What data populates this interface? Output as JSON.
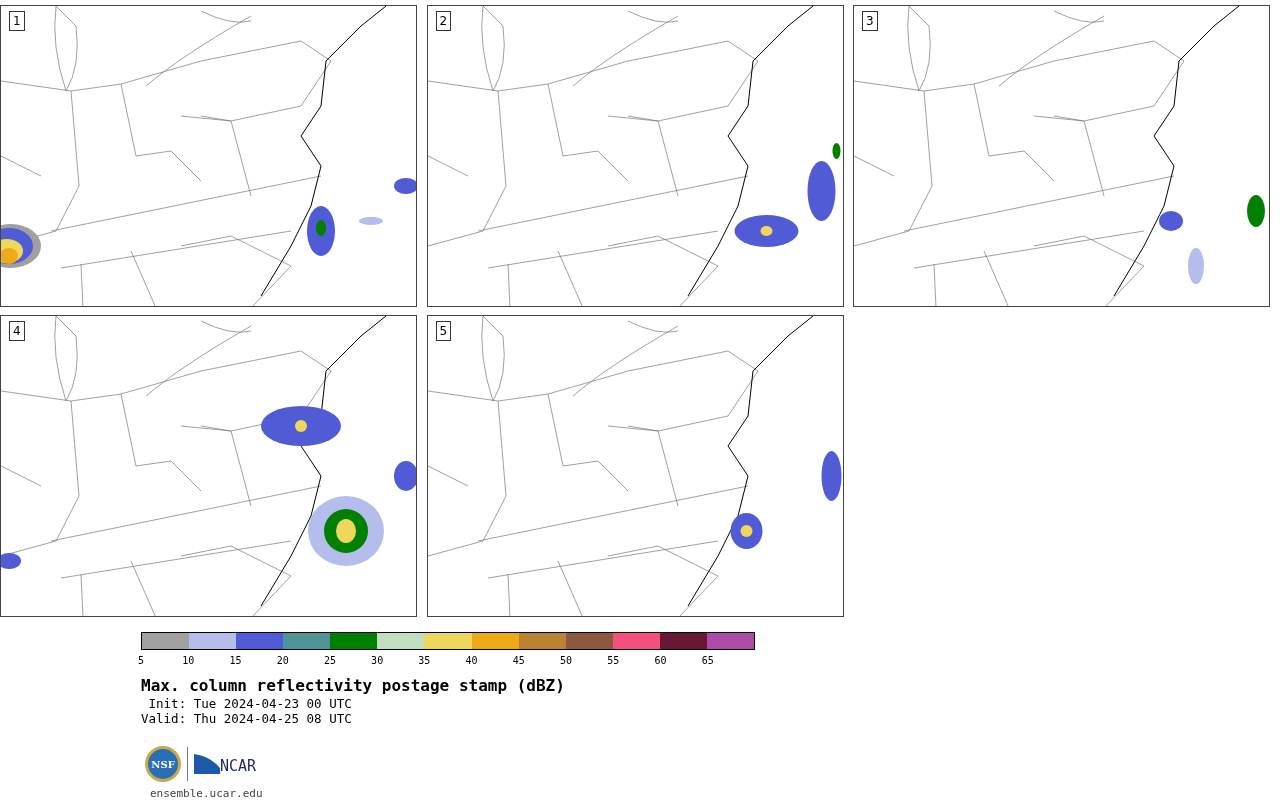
{
  "panels": [
    {
      "label": "1"
    },
    {
      "label": "2"
    },
    {
      "label": "3"
    },
    {
      "label": "4"
    },
    {
      "label": "5"
    }
  ],
  "colorbar": {
    "segments": [
      {
        "color": "#a0a0a0"
      },
      {
        "color": "#b4bdec"
      },
      {
        "color": "#525bd6"
      },
      {
        "color": "#4e9499"
      },
      {
        "color": "#008000"
      },
      {
        "color": "#bfdfbf"
      },
      {
        "color": "#efd75b"
      },
      {
        "color": "#efaa18"
      },
      {
        "color": "#bc8232"
      },
      {
        "color": "#8b5a3e"
      },
      {
        "color": "#f44f7d"
      },
      {
        "color": "#661834"
      },
      {
        "color": "#ad4ca6"
      }
    ],
    "ticks": [
      "5",
      "10",
      "15",
      "20",
      "25",
      "30",
      "35",
      "40",
      "45",
      "50",
      "55",
      "60",
      "65"
    ]
  },
  "title": "Max. column reflectivity postage stamp (dBZ)",
  "init": " Init: Tue 2024-04-23 00 UTC",
  "valid": "Valid: Thu 2024-04-25 08 UTC",
  "logos": {
    "nsf": "NSF",
    "ncar": "NCAR"
  },
  "footer": "ensemble.ucar.edu"
}
